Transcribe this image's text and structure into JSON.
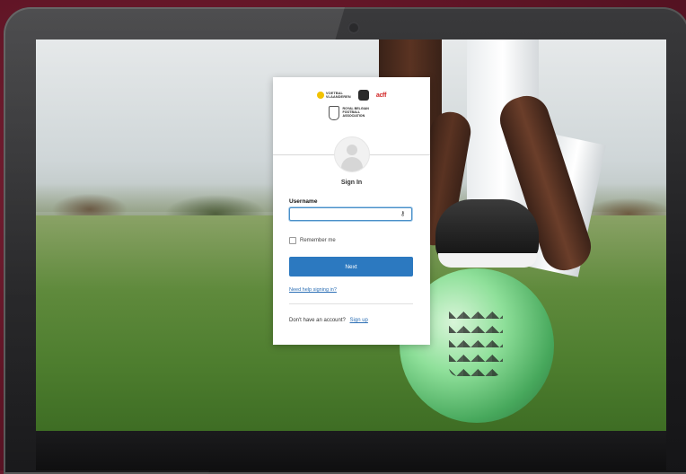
{
  "colors": {
    "primary_button": "#2c79c0",
    "link": "#2c6fb5",
    "background": "#6a1a2c"
  },
  "logos": {
    "voetbal_vlaanderen": "VOETBAL VLAANDEREN",
    "acff": "acff",
    "rbfa": "ROYAL BELGIAN FOOTBALL ASSOCIATION"
  },
  "login": {
    "title": "Sign In",
    "username_label": "Username",
    "username_value": "",
    "remember_label": "Remember me",
    "next_label": "Next",
    "help_link": "Need help signing in?",
    "no_account_text": "Don't have an account?",
    "signup_link": "Sign up"
  },
  "icons": {
    "password_manager": "key-icon",
    "avatar": "user-avatar-icon"
  }
}
